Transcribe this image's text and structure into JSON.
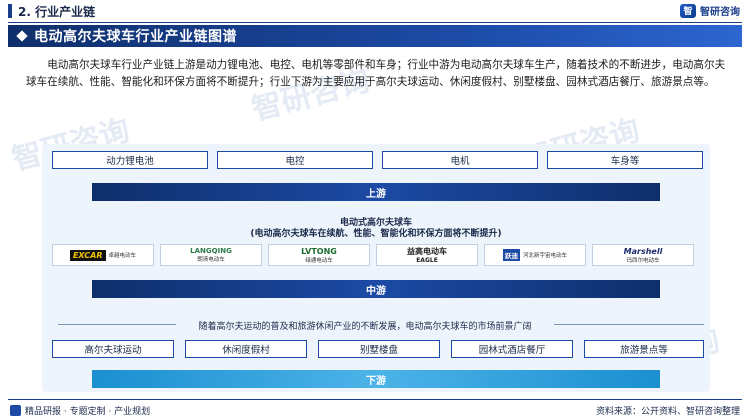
{
  "header": {
    "section": "2. 行业产业链",
    "brand": "智研咨询",
    "brand_logo_glyph": "智"
  },
  "title": "电动高尔夫球车行业产业链图谱",
  "intro": "电动高尔夫球车行业产业链上游是动力锂电池、电控、电机等零部件和车身；行业中游为电动高尔夫球车生产，随着技术的不断进步，电动高尔夫球车在续航、性能、智能化和环保方面将不断提升；行业下游为主要应用于高尔夫球运动、休闲度假村、别墅楼盘、园林式酒店餐厅、旅游景点等。",
  "upstream": {
    "items": [
      "动力锂电池",
      "电控",
      "电机",
      "车身等"
    ],
    "label": "上游"
  },
  "midstream": {
    "title": "电动式高尔夫球车",
    "subtitle": "(电动高尔夫球车在续航、性能、智能化和环保方面将不断提升)",
    "companies": [
      {
        "logo": "EXCAR",
        "name": "卓越电动车"
      },
      {
        "logo": "LANGQING",
        "name": "朗清电动车"
      },
      {
        "logo": "LVTONG",
        "name": "绿通电动车"
      },
      {
        "logo": "益高电动车",
        "name": "EAGLE"
      },
      {
        "logo": "跃迪",
        "name": "河北新宇宙电动车"
      },
      {
        "logo": "Marshell",
        "name": "玛西尔电动车"
      }
    ],
    "label": "中游"
  },
  "downstream": {
    "trend": "随着高尔夫运动的普及和旅游休闲产业的不断发展，电动高尔夫球车的市场前景广阔",
    "items": [
      "高尔夫球运动",
      "休闲度假村",
      "别墅楼盘",
      "园林式酒店餐厅",
      "旅游景点等"
    ],
    "label": "下游"
  },
  "footer": {
    "left": "精品研报 · 专题定制 · 产业规划",
    "right": "资料来源：公开资料、智研咨询整理"
  },
  "watermark": "智研咨询",
  "colors": {
    "navy": "#0f2f6b",
    "blue": "#1c4aa5",
    "light_blue": "#4cb3e8",
    "panel": "#eef4fb"
  }
}
